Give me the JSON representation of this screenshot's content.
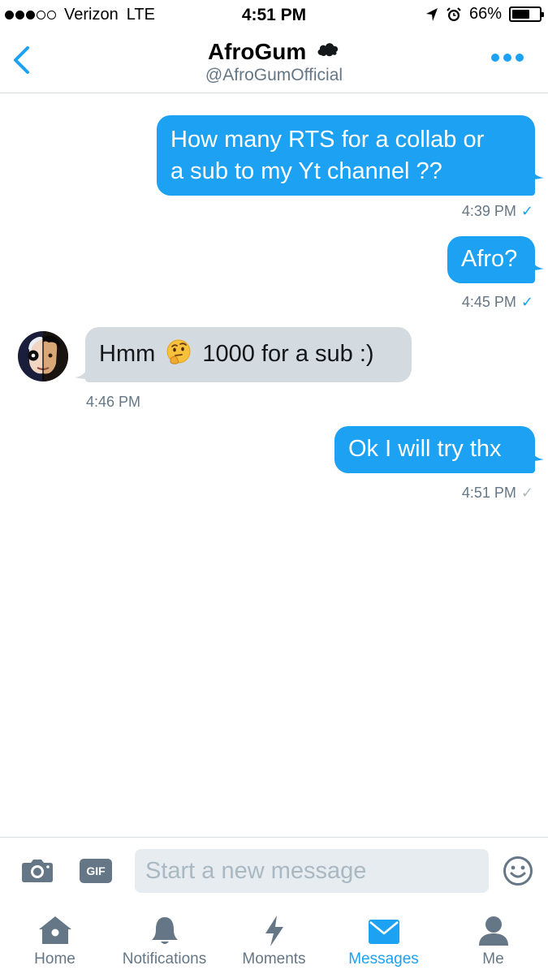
{
  "status_bar": {
    "carrier": "Verizon",
    "network": "LTE",
    "time": "4:51 PM",
    "battery": "66%",
    "battery_level": 0.66,
    "signal_bars": 3,
    "signal_total": 5
  },
  "header": {
    "name": "AfroGum",
    "handle": "@AfroGumOfficial"
  },
  "messages": [
    {
      "direction": "out",
      "lines": [
        "How many RTS for a collab or",
        "a sub to my Yt channel ??"
      ],
      "time": "4:39 PM",
      "check": "✓",
      "read": true
    },
    {
      "direction": "out",
      "text": "Afro?",
      "time": "4:45 PM",
      "check": "✓",
      "read": true
    },
    {
      "direction": "in",
      "text_before": "Hmm",
      "emoji": "thinking-face",
      "text_after": "1000 for a sub :)",
      "time": "4:46 PM"
    },
    {
      "direction": "out",
      "text": "Ok I will try thx",
      "time": "4:51 PM",
      "check": "✓",
      "read": false
    }
  ],
  "composer": {
    "gif_label": "GIF",
    "placeholder": "Start a new message"
  },
  "tabs": [
    {
      "label": "Home",
      "icon": "home-icon",
      "active": false
    },
    {
      "label": "Notifications",
      "icon": "bell-icon",
      "active": false
    },
    {
      "label": "Moments",
      "icon": "lightning-icon",
      "active": false
    },
    {
      "label": "Messages",
      "icon": "envelope-icon",
      "active": true
    },
    {
      "label": "Me",
      "icon": "person-icon",
      "active": false
    }
  ],
  "colors": {
    "accent": "#1da1f2",
    "incoming_bubble": "#d3dae0",
    "muted": "#657786"
  }
}
